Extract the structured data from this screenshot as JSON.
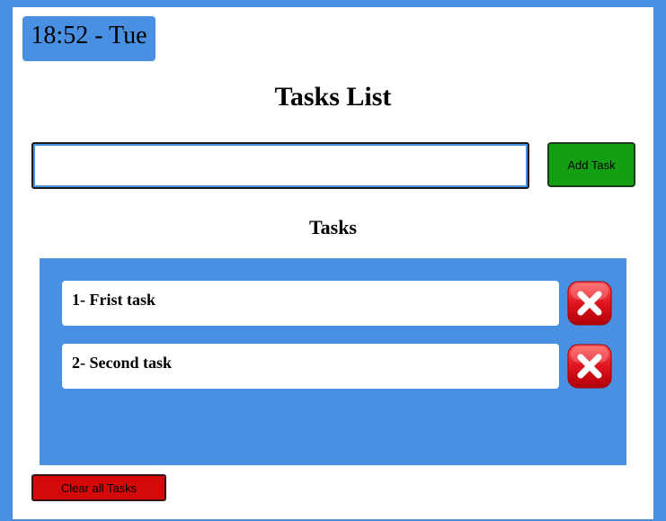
{
  "clock": {
    "text": "18:52 - Tue"
  },
  "header": {
    "title": "Tasks List"
  },
  "form": {
    "input_value": "",
    "input_placeholder": "",
    "add_label": "Add Task",
    "add_color": "#12a012"
  },
  "tasks_section": {
    "heading": "Tasks",
    "items": [
      {
        "label": "1- Frist task",
        "delete_icon": "close-icon"
      },
      {
        "label": "2- Second task",
        "delete_icon": "close-icon"
      }
    ]
  },
  "footer": {
    "clear_label": "Clear all Tasks",
    "clear_color": "#d40a0a"
  },
  "theme": {
    "accent": "#4a90e2",
    "delete_red": "#e0141e"
  }
}
